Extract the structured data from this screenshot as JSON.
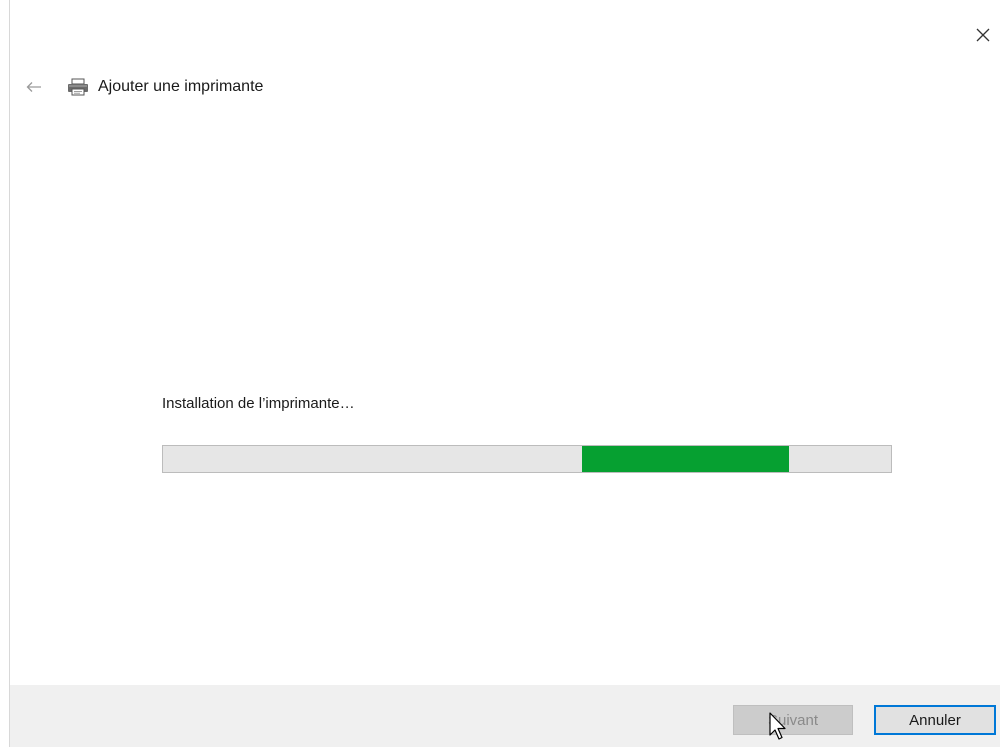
{
  "window": {
    "title": "Ajouter une imprimante",
    "close_icon": "close-icon",
    "back_icon": "back-arrow-icon",
    "printer_icon": "printer-icon"
  },
  "main": {
    "status_text": "Installation de l’imprimante…",
    "progress": {
      "style": "indeterminate marquee",
      "segment_start_fraction": 0.576,
      "segment_end_fraction": 0.86,
      "color": "#06a031"
    }
  },
  "footer": {
    "next_label": "Suivant",
    "next_disabled": true,
    "cancel_label": "Annuler",
    "accent": "#0078d7"
  }
}
